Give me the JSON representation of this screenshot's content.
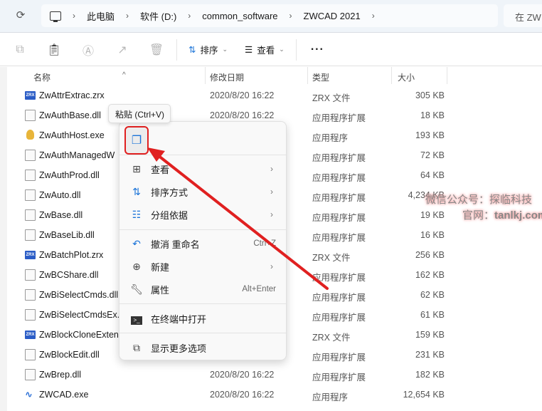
{
  "address_bar": {
    "crumbs": [
      "此电脑",
      "软件 (D:)",
      "common_software",
      "ZWCAD 2021"
    ],
    "search_placeholder": "在 ZW"
  },
  "toolbar": {
    "sort_label": "排序",
    "view_label": "查看",
    "more_label": "···"
  },
  "columns": {
    "name": "名称",
    "date": "修改日期",
    "type": "类型",
    "size": "大小"
  },
  "files": [
    {
      "name": "ZwAttrExtrac.zrx",
      "date": "2020/8/20 16:22",
      "type": "ZRX 文件",
      "size": "305 KB",
      "icon": "zrx"
    },
    {
      "name": "ZwAuthBase.dll",
      "date": "2020/8/20 16:22",
      "type": "应用程序扩展",
      "size": "18 KB",
      "icon": "dll"
    },
    {
      "name": "ZwAuthHost.exe",
      "date": null,
      "type": "应用程序",
      "size": "193 KB",
      "icon": "exe"
    },
    {
      "name": "ZwAuthManagedW",
      "date": null,
      "type": "应用程序扩展",
      "size": "72 KB",
      "icon": "dll"
    },
    {
      "name": "ZwAuthProd.dll",
      "date": null,
      "type": "应用程序扩展",
      "size": "64 KB",
      "icon": "dll"
    },
    {
      "name": "ZwAuto.dll",
      "date": null,
      "type": "应用程序扩展",
      "size": "4,234 KB",
      "icon": "dll"
    },
    {
      "name": "ZwBase.dll",
      "date": null,
      "type": "应用程序扩展",
      "size": "19 KB",
      "icon": "dll"
    },
    {
      "name": "ZwBaseLib.dll",
      "date": null,
      "type": "应用程序扩展",
      "size": "16 KB",
      "icon": "dll"
    },
    {
      "name": "ZwBatchPlot.zrx",
      "date": null,
      "type": "ZRX 文件",
      "size": "256 KB",
      "icon": "zrx"
    },
    {
      "name": "ZwBCShare.dll",
      "date": null,
      "type": "应用程序扩展",
      "size": "162 KB",
      "icon": "dll"
    },
    {
      "name": "ZwBiSelectCmds.dll",
      "date": null,
      "type": "应用程序扩展",
      "size": "62 KB",
      "icon": "dll"
    },
    {
      "name": "ZwBiSelectCmdsEx.",
      "date": null,
      "type": "应用程序扩展",
      "size": "61 KB",
      "icon": "dll"
    },
    {
      "name": "ZwBlockCloneExten",
      "date": null,
      "type": "ZRX 文件",
      "size": "159 KB",
      "icon": "zrx"
    },
    {
      "name": "ZwBlockEdit.dll",
      "date": null,
      "type": "应用程序扩展",
      "size": "231 KB",
      "icon": "dll"
    },
    {
      "name": "ZwBrep.dll",
      "date": "2020/8/20 16:22",
      "type": "应用程序扩展",
      "size": "182 KB",
      "icon": "dll"
    },
    {
      "name": "ZWCAD.exe",
      "date": "2020/8/20 16:22",
      "type": "应用程序",
      "size": "12,654 KB",
      "icon": "cad"
    }
  ],
  "tooltip": "粘贴 (Ctrl+V)",
  "context_menu": {
    "items": [
      {
        "label": "查看",
        "shortcut": "",
        "submenu": true,
        "icon": "grid-icon"
      },
      {
        "label": "排序方式",
        "shortcut": "",
        "submenu": true,
        "icon": "sort-icon"
      },
      {
        "label": "分组依据",
        "shortcut": "",
        "submenu": true,
        "icon": "group-icon"
      },
      {
        "label": "撤消 重命名",
        "shortcut": "Ctrl+Z",
        "submenu": false,
        "icon": "undo-icon"
      },
      {
        "label": "新建",
        "shortcut": "",
        "submenu": true,
        "icon": "new-icon"
      },
      {
        "label": "属性",
        "shortcut": "Alt+Enter",
        "submenu": false,
        "icon": "wrench-icon"
      },
      {
        "label": "在终端中打开",
        "shortcut": "",
        "submenu": false,
        "icon": "terminal-icon"
      },
      {
        "label": "显示更多选项",
        "shortcut": "",
        "submenu": false,
        "icon": "more-options-icon"
      }
    ]
  },
  "watermark": {
    "line1": "微信公众号：探临科技",
    "line2_prefix": "官网：",
    "line2_site": "tanlkj.com"
  },
  "colors": {
    "accent": "#1a73d8",
    "annotation": "#e02020"
  }
}
